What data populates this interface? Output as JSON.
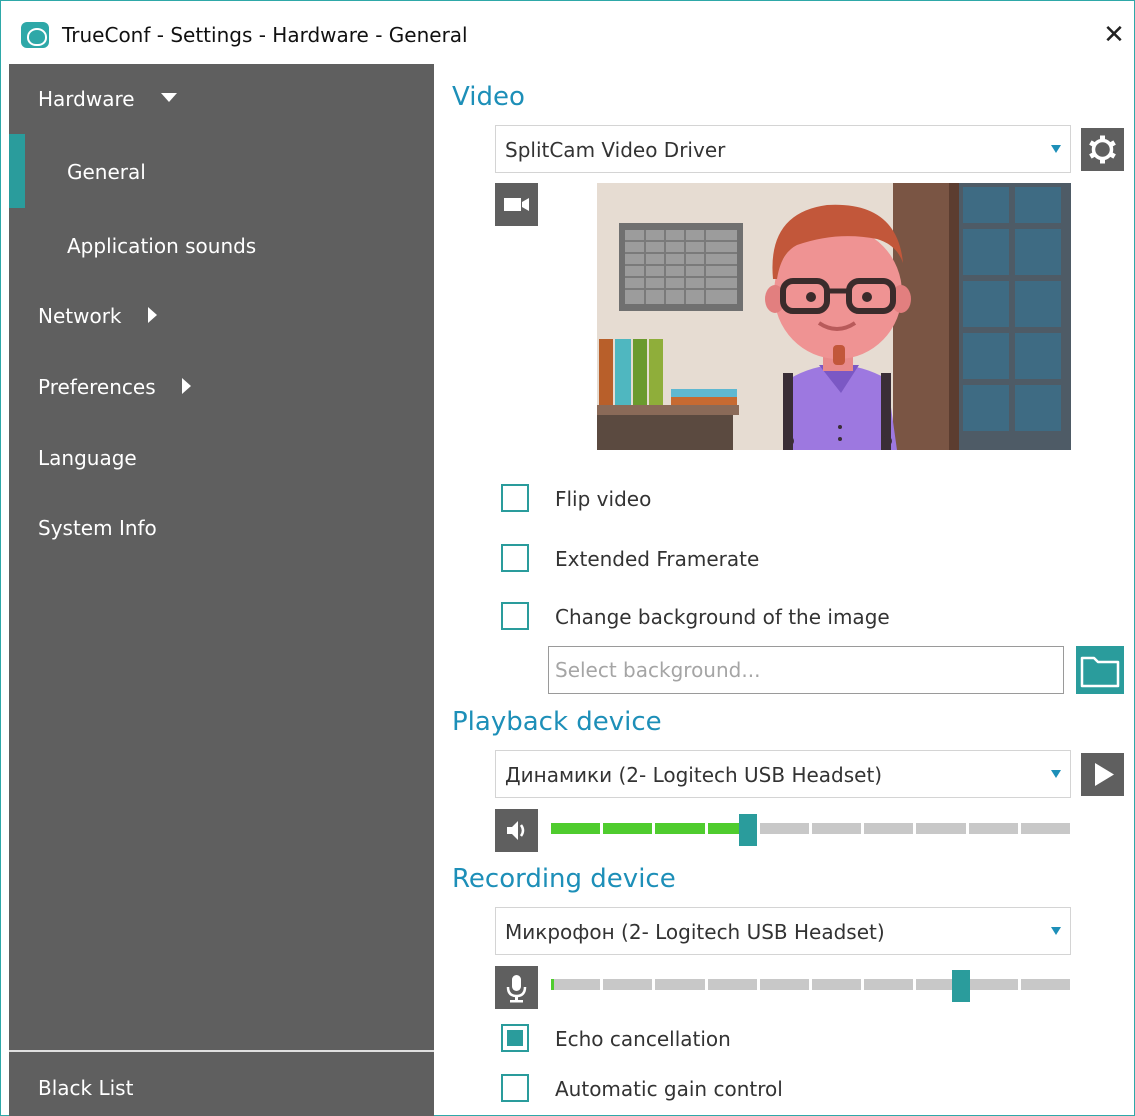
{
  "window": {
    "title": "TrueConf - Settings - Hardware - General",
    "close_glyph": "✕"
  },
  "sidebar": {
    "items": [
      {
        "label": "Hardware",
        "arrow": "down"
      },
      {
        "label": "General",
        "sub": true,
        "active": true
      },
      {
        "label": "Application sounds",
        "sub": true
      },
      {
        "label": "Network",
        "arrow": "right"
      },
      {
        "label": "Preferences",
        "arrow": "right"
      },
      {
        "label": "Language"
      },
      {
        "label": "System Info"
      }
    ],
    "footer_item": "Black List"
  },
  "video": {
    "title": "Video",
    "device": "SplitCam Video Driver",
    "options": [
      {
        "label": "Flip video",
        "checked": false
      },
      {
        "label": "Extended Framerate",
        "checked": false
      },
      {
        "label": "Change background of the image",
        "checked": false
      }
    ],
    "background_placeholder": "Select background..."
  },
  "playback": {
    "title": "Playback device",
    "device": "Динамики (2- Logitech USB Headset)",
    "volume_percent": 38
  },
  "recording": {
    "title": "Recording device",
    "device": "Микрофон (2- Logitech USB Headset)",
    "gain_percent": 79,
    "level_percent": 0.5,
    "options": [
      {
        "label": "Echo cancellation",
        "checked": true
      },
      {
        "label": "Automatic gain control",
        "checked": false
      }
    ]
  },
  "colors": {
    "accent": "#2a9c9c",
    "title_blue": "#1d8fb8",
    "sidebar_bg": "#5f5f5f",
    "level_green": "#4fcc2e"
  },
  "icons": [
    "app-logo-icon",
    "close-icon",
    "gear-icon",
    "camera-icon",
    "folder-icon",
    "play-icon",
    "speaker-icon",
    "microphone-icon"
  ]
}
